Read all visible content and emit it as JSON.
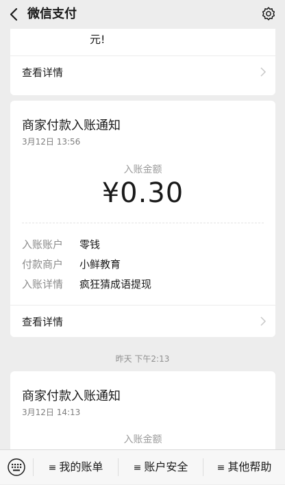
{
  "header": {
    "title": "微信支付"
  },
  "prev_card": {
    "content_tail": "元!",
    "detail_label": "查看详情"
  },
  "cards": [
    {
      "title": "商家付款入账通知",
      "time": "3月12日 13:56",
      "amount_label": "入账金额",
      "amount": "¥0.30",
      "rows": [
        {
          "label": "入账账户",
          "value": "零钱"
        },
        {
          "label": "付款商户",
          "value": "小鲜教育"
        },
        {
          "label": "入账详情",
          "value": "疯狂猜成语提现"
        }
      ],
      "detail_label": "查看详情"
    },
    {
      "title": "商家付款入账通知",
      "time": "3月12日 14:13",
      "amount_label": "入账金额"
    }
  ],
  "timestamp": "昨天 下午2:13",
  "bottom_menu": [
    {
      "label": "我的账单",
      "icon": "≡"
    },
    {
      "label": "账户安全",
      "icon": "≡"
    },
    {
      "label": "其他帮助",
      "icon": "≡"
    }
  ],
  "icons": [
    "back-icon",
    "gear-icon",
    "chevron-right-icon",
    "keyboard-icon"
  ]
}
